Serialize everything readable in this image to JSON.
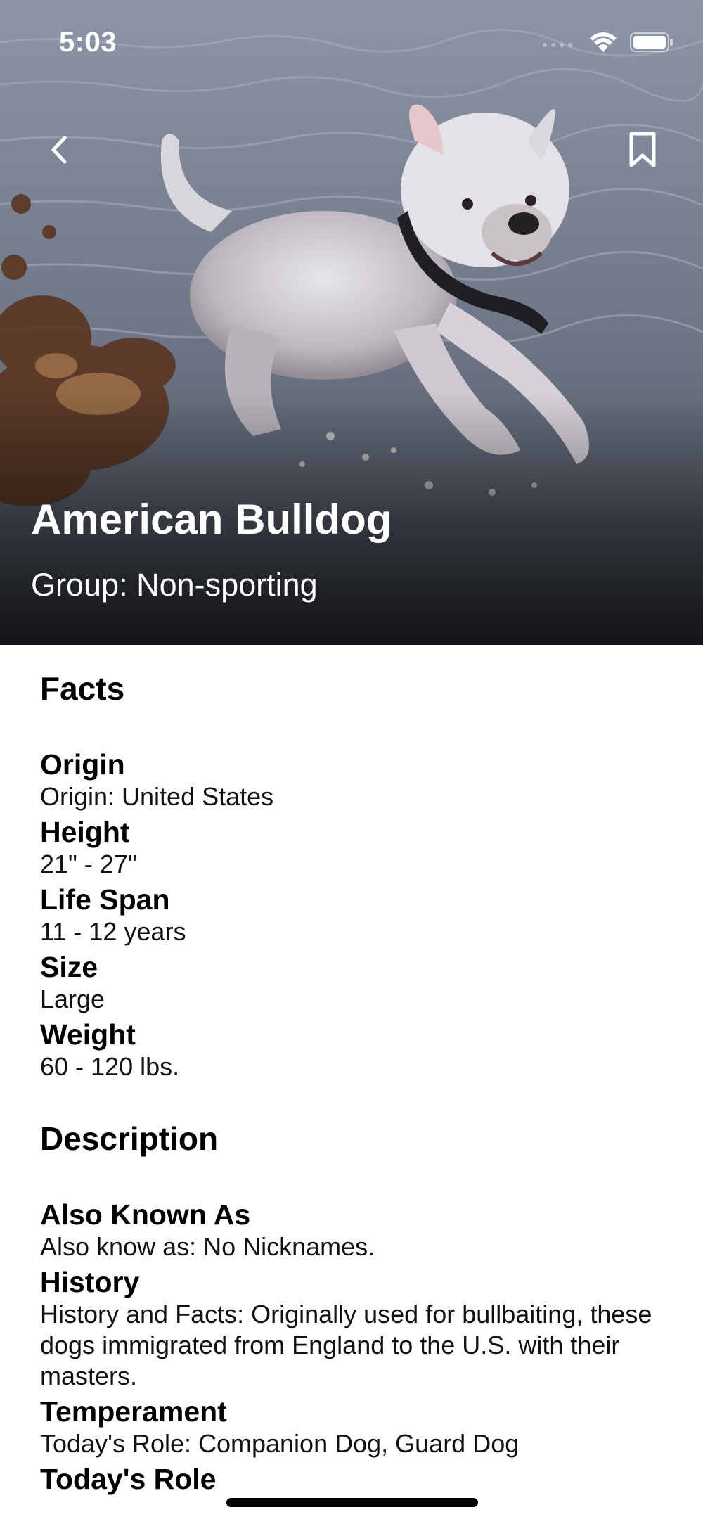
{
  "status_bar": {
    "time": "5:03"
  },
  "nav": {
    "back_icon": "chevron-left-icon",
    "bookmark_icon": "bookmark-icon"
  },
  "hero": {
    "title": "American Bulldog",
    "group": "Group: Non-sporting"
  },
  "facts": {
    "section_title": "Facts",
    "items": [
      {
        "label": "Origin",
        "value": "Origin: United States"
      },
      {
        "label": "Height",
        "value": "21\" - 27\""
      },
      {
        "label": "Life Span",
        "value": "11 - 12 years"
      },
      {
        "label": "Size",
        "value": "Large"
      },
      {
        "label": "Weight",
        "value": "60 - 120 lbs."
      }
    ]
  },
  "description": {
    "section_title": "Description",
    "items": [
      {
        "label": "Also Known As",
        "value": "Also know as: No Nicknames."
      },
      {
        "label": "History",
        "value": "History and Facts: Originally used for bullbaiting, these dogs immigrated from England to the U.S. with their masters."
      },
      {
        "label": "Temperament",
        "value": "Today's Role: Companion Dog, Guard Dog"
      },
      {
        "label": "Today's Role",
        "value": ""
      }
    ]
  },
  "colors": {
    "text": "#000000",
    "hero_text": "#ffffff",
    "background": "#ffffff"
  }
}
